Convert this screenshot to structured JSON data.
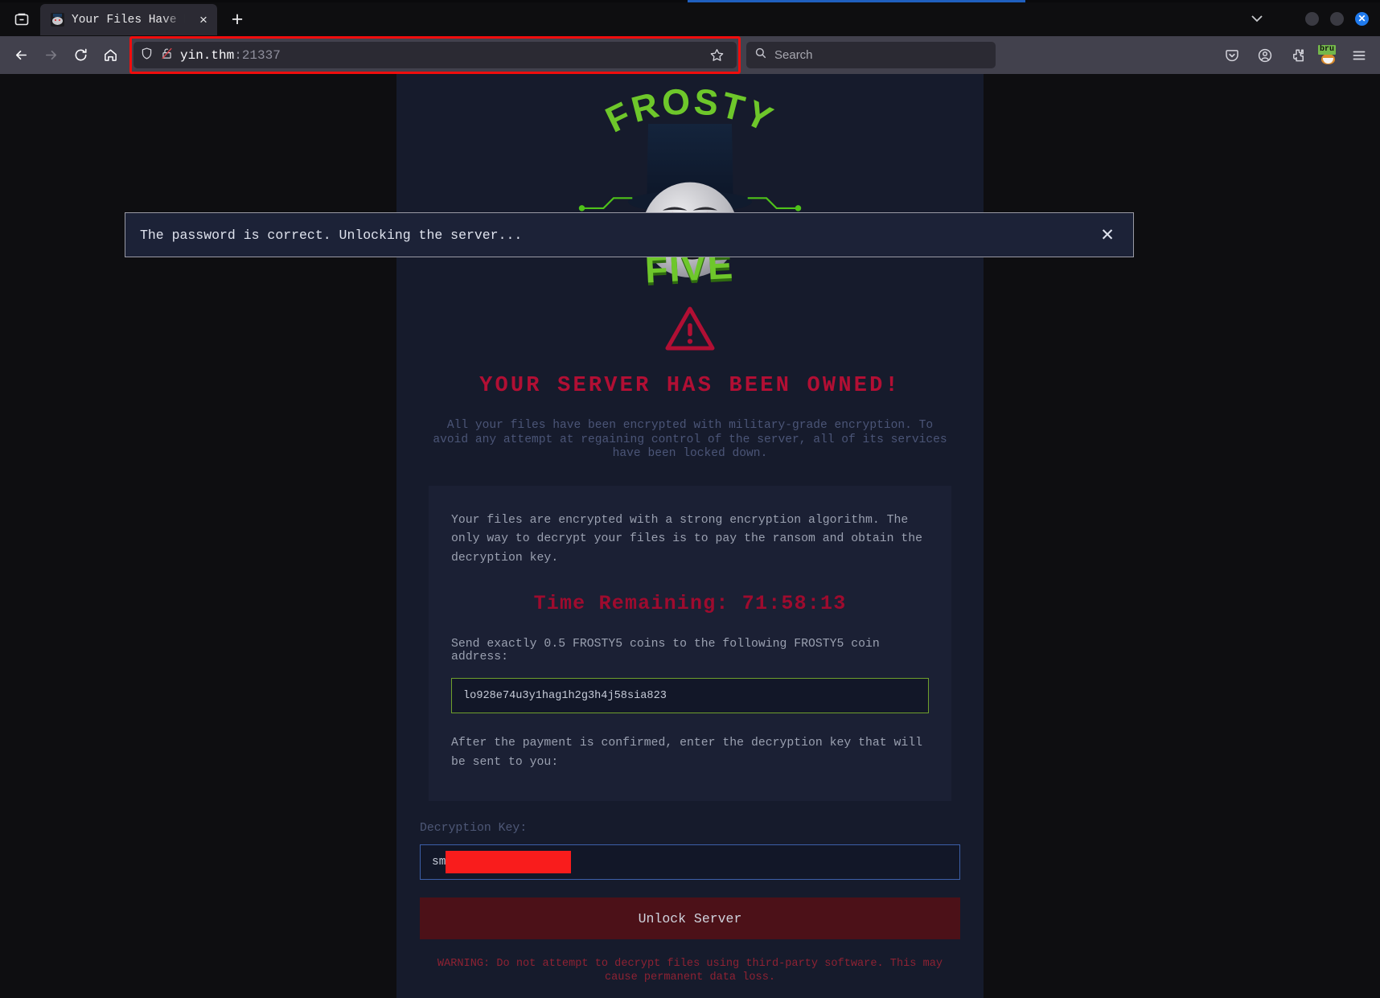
{
  "browser": {
    "firefox_view_icon": "firefox-view-icon",
    "tab": {
      "title": "Your Files Have Bee",
      "favicon": "snowman-favicon",
      "close_label": "×"
    },
    "newtab_label": "+",
    "window_controls": {
      "chevron": "⌄",
      "minimize": "",
      "maximize": "",
      "close": "✕"
    },
    "nav": {
      "back_icon": "back-arrow-icon",
      "forward_icon": "forward-arrow-icon",
      "reload_icon": "reload-icon",
      "home_icon": "home-icon",
      "shield_icon": "shield-icon",
      "lock_icon": "broken-lock-icon",
      "star_icon": "bookmark-star-icon",
      "url_host": "yin.thm",
      "url_port": ":21337",
      "url_full": "yin.thm:21337"
    },
    "search": {
      "placeholder": "Search",
      "icon": "magnifier-icon"
    },
    "toolbar_right": {
      "pocket_icon": "pocket-icon",
      "account_icon": "account-circle-icon",
      "extensions_icon": "extensions-puzzle-icon",
      "ext_badge_label": "bru",
      "menu_icon": "hamburger-menu-icon"
    }
  },
  "banner": {
    "message": "The password is correct. Unlocking the server...",
    "close_label": "✕"
  },
  "page": {
    "logo": {
      "top_word": "FROSTY",
      "bottom_word": "FIVE",
      "alt": "frosty-five-snowman-logo"
    },
    "warning_icon": "warning-triangle-icon",
    "title": "YOUR SERVER HAS BEEN OWNED!",
    "intro": "All your files have been encrypted with military-grade encryption. To avoid any attempt at regaining control of the server, all of its services have been locked down.",
    "ransom": {
      "paragraph": "Your files are encrypted with a strong encryption algorithm. The only way to decrypt your files is to pay the ransom and obtain the decryption key.",
      "timer": "Time Remaining: 71:58:13",
      "send_instruction": "Send exactly 0.5 FROSTY5 coins to the following FROSTY5 coin address:",
      "coin_address": "lo928e74u3y1hag1h2g3h4j58sia823",
      "after_payment": "After the payment is confirmed, enter the decryption key that will be sent to you:"
    },
    "form": {
      "key_label": "Decryption Key:",
      "key_value": "sm",
      "key_redacted": true,
      "unlock_label": "Unlock Server"
    },
    "final_warning": "WARNING: Do not attempt to decrypt files using third-party software. This may cause permanent data loss."
  },
  "colors": {
    "page_bg": "#161b2c",
    "accent_red": "#b10f34",
    "accent_green": "#6f9f2c",
    "logo_green": "#6ec72b",
    "timer_red": "#9e0b2e",
    "redaction": "#f91c1c",
    "button_bg": "#4c1118",
    "link_blue": "#3c5fa8"
  }
}
